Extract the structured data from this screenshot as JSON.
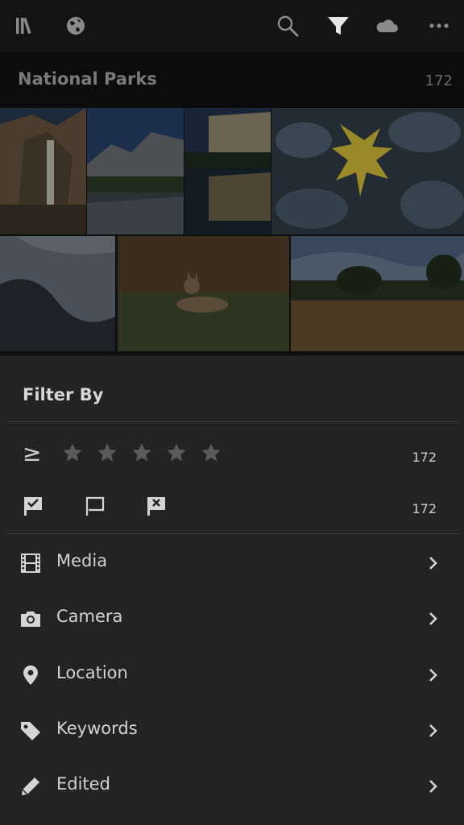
{
  "topbar": {
    "icons": [
      "library-icon",
      "globe-icon",
      "search-icon",
      "filter-icon",
      "cloud-icon",
      "more-icon"
    ]
  },
  "album": {
    "title": "National Parks",
    "count": "172"
  },
  "photos": [
    {
      "subject": "waterfall"
    },
    {
      "subject": "valley"
    },
    {
      "subject": "cliff-reflection"
    },
    {
      "subject": "frost-leaf"
    },
    {
      "subject": "frost-ground"
    },
    {
      "subject": "coyote"
    },
    {
      "subject": "meadow"
    }
  ],
  "filter": {
    "title": "Filter By",
    "rating_symbol": "≥",
    "rating_count": "172",
    "flag_count": "172",
    "items": [
      {
        "label": "Media",
        "icon": "film-icon"
      },
      {
        "label": "Camera",
        "icon": "camera-icon"
      },
      {
        "label": "Location",
        "icon": "location-pin-icon"
      },
      {
        "label": "Keywords",
        "icon": "tag-icon"
      },
      {
        "label": "Edited",
        "icon": "pencil-icon"
      }
    ]
  },
  "colors": {
    "background": "#232323",
    "star_inactive": "#5a5a5a",
    "text": "#d2d2d2"
  }
}
